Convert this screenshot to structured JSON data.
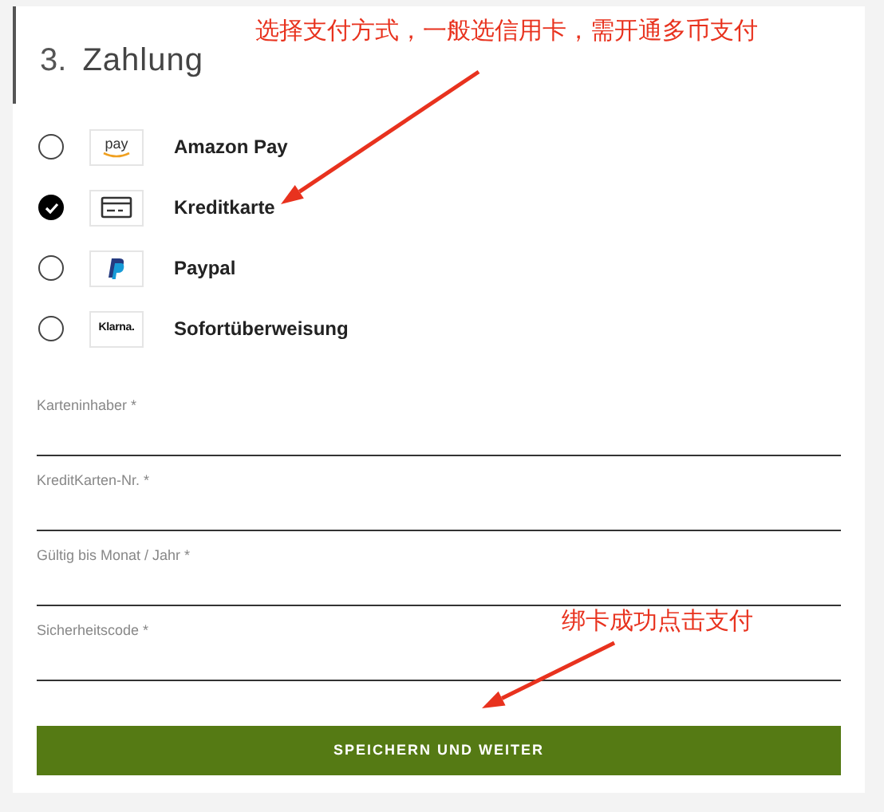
{
  "section": {
    "number": "3.",
    "title": "Zahlung"
  },
  "payment_methods": [
    {
      "label": "Amazon Pay",
      "kind": "amazon",
      "logo_text": "pay",
      "selected": false
    },
    {
      "label": "Kreditkarte",
      "kind": "card",
      "selected": true
    },
    {
      "label": "Paypal",
      "kind": "paypal",
      "selected": false
    },
    {
      "label": "Sofortüberweisung",
      "kind": "klarna",
      "logo_text": "Klarna.",
      "selected": false
    }
  ],
  "fields": [
    {
      "label": "Karteninhaber *"
    },
    {
      "label": "KreditKarten-Nr. *"
    },
    {
      "label": "Gültig bis Monat / Jahr *"
    },
    {
      "label": "Sicherheitscode *"
    }
  ],
  "submit_button": "SPEICHERN UND WEITER",
  "annotations": [
    {
      "text": "选择支付方式，一般选信用卡，需开通多币支付"
    },
    {
      "text": "绑卡成功点击支付"
    }
  ]
}
